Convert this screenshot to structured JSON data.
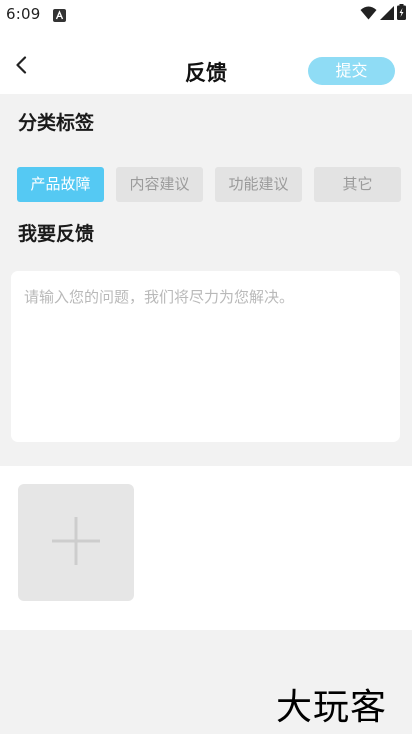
{
  "status_bar": {
    "time": "6:09"
  },
  "header": {
    "title": "反馈",
    "submit_label": "提交"
  },
  "category": {
    "title": "分类标签",
    "tags": [
      {
        "label": "产品故障",
        "active": true
      },
      {
        "label": "内容建议",
        "active": false
      },
      {
        "label": "功能建议",
        "active": false
      },
      {
        "label": "其它",
        "active": false
      }
    ]
  },
  "feedback": {
    "title": "我要反馈",
    "placeholder": "请输入您的问题，我们将尽力为您解决。"
  },
  "watermark": {
    "text": "大玩客"
  },
  "colors": {
    "accent": "#55c9f3",
    "submit_bg": "#8fdcf5",
    "page_bg": "#f2f2f2"
  }
}
